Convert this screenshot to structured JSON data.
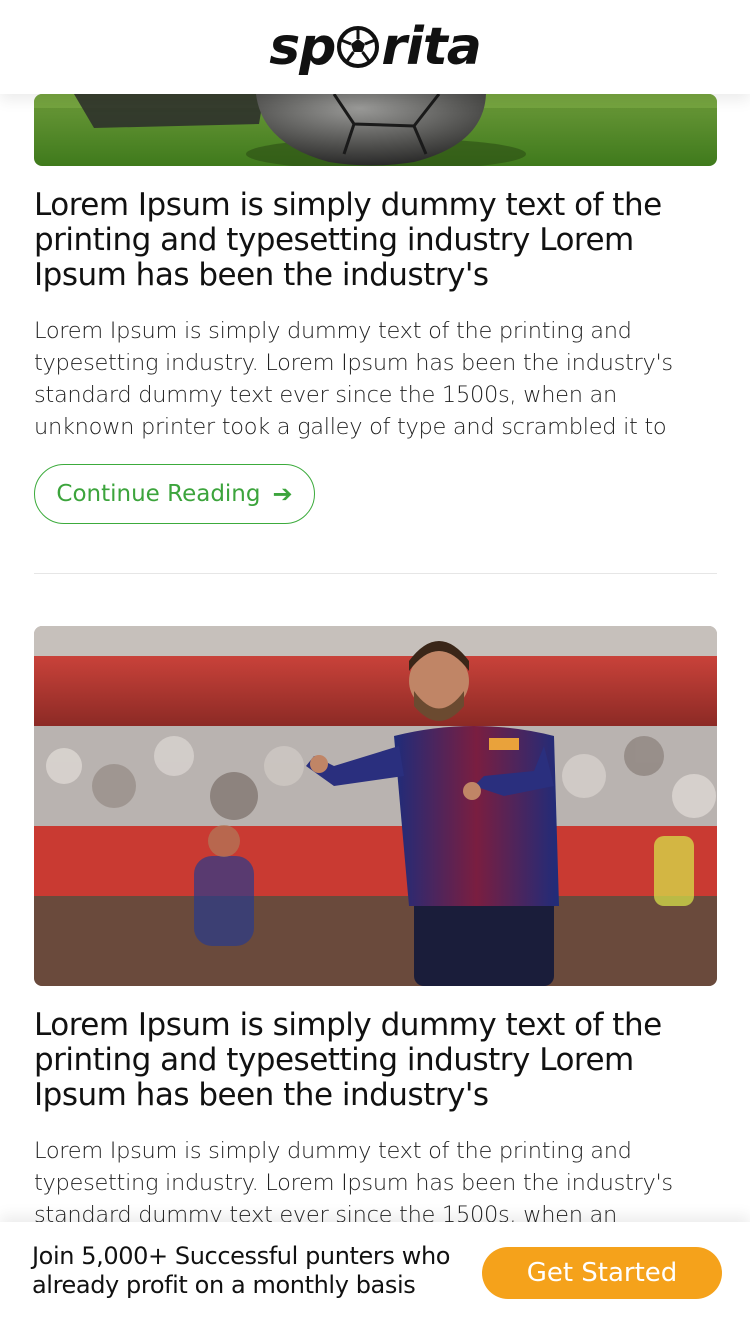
{
  "header": {
    "logo_left": "sp",
    "logo_right": "rita",
    "logo_icon": "soccer-ball-icon"
  },
  "articles": [
    {
      "title": "Lorem Ipsum is simply dummy text of the printing and typesetting industry Lorem Ipsum has been the industry's",
      "excerpt": "Lorem Ipsum is simply dummy text of the printing and typesetting industry. Lorem Ipsum has been the industry's standard dummy text ever since the 1500s, when an unknown printer took a galley of type and scrambled it to",
      "button": {
        "label": "Continue Reading",
        "icon": "arrow-right-icon"
      }
    },
    {
      "title": "Lorem Ipsum is simply dummy text of the printing and typesetting industry Lorem Ipsum has been the industry's",
      "excerpt": "Lorem Ipsum is simply dummy text of the printing and typesetting industry. Lorem Ipsum has been the industry's standard dummy text ever since the 1500s, when an"
    }
  ],
  "cta": {
    "text": "Join 5,000+ Successful punters who already profit on a monthly basis",
    "button_label": "Get Started"
  },
  "colors": {
    "accent_green": "#3ca43c",
    "cta_orange": "#f5a21b"
  }
}
